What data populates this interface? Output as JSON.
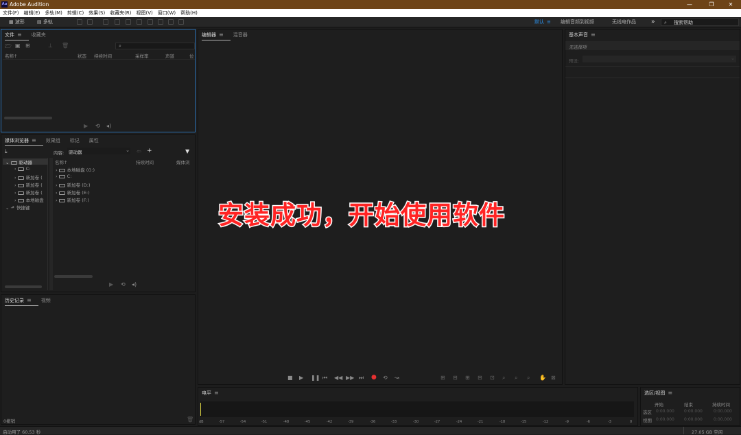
{
  "titlebar": {
    "app_icon": "Au",
    "title": "Adobe Audition",
    "min": "—",
    "max": "❐",
    "close": "✕"
  },
  "menu": [
    "文件(F)",
    "编辑(E)",
    "多轨(M)",
    "剪辑(C)",
    "效果(S)",
    "收藏夹(R)",
    "视图(V)",
    "窗口(W)",
    "帮助(H)"
  ],
  "toolbar": {
    "waveform": "波形",
    "multitrack": "多轨",
    "workspaces": [
      "默认",
      "编辑音频到视频",
      "无线电作品"
    ],
    "more": "»",
    "search_placeholder": "搜索帮助"
  },
  "files_panel": {
    "tabs": [
      "文件",
      "收藏夹"
    ],
    "columns": [
      "名称↑",
      "状态",
      "持续时间",
      "采样率",
      "声道",
      "位"
    ]
  },
  "media_panel": {
    "tabs": [
      "媒体浏览器",
      "效果组",
      "标记",
      "属性"
    ],
    "content_label": "内容:",
    "content_value": "驱动器",
    "tree": [
      "驱动器",
      "C:",
      "新加卷 (",
      "新加卷 (",
      "新加卷 (",
      "本地磁盘",
      "快捷键"
    ],
    "columns": [
      "名称↑",
      "持续时间",
      "媒体浏"
    ],
    "files": [
      "本地磁盘 (G:)",
      "C:",
      "新加卷 (D:)",
      "新加卷 (E:)",
      "新加卷 (F:)"
    ]
  },
  "history_panel": {
    "tabs": [
      "历史记录",
      "视频"
    ],
    "footer": "0撤销"
  },
  "editor_panel": {
    "tabs": [
      "编辑器",
      "混音器"
    ]
  },
  "essential_panel": {
    "title": "基本声音",
    "no_selection": "无选择项",
    "preset_label": "预设:"
  },
  "overlay": {
    "text": "安装成功，开始使用软件"
  },
  "levels_panel": {
    "title": "电平",
    "ticks": [
      "dB",
      "-57",
      "-54",
      "-51",
      "-48",
      "-45",
      "-42",
      "-39",
      "-36",
      "-33",
      "-30",
      "-27",
      "-24",
      "-21",
      "-18",
      "-15",
      "-12",
      "-9",
      "-6",
      "-3",
      "0"
    ]
  },
  "selection_panel": {
    "title": "选区/视图",
    "headers": [
      "开始",
      "结束",
      "持续时间"
    ],
    "rows": [
      {
        "label": "选区",
        "start": "0:00.000",
        "end": "0:00.000",
        "dur": "0:00.000"
      },
      {
        "label": "视图",
        "start": "0:00.000",
        "end": "0:00.000",
        "dur": "0:00.000"
      }
    ]
  },
  "status": {
    "left": "启动用了 60.53 秒",
    "right": "27.05 GB 空闲"
  },
  "colors": {
    "titlebar": "#6e4417",
    "accent": "#2b8fe8",
    "record": "#e53030",
    "overlay_text": "#ff2424"
  }
}
